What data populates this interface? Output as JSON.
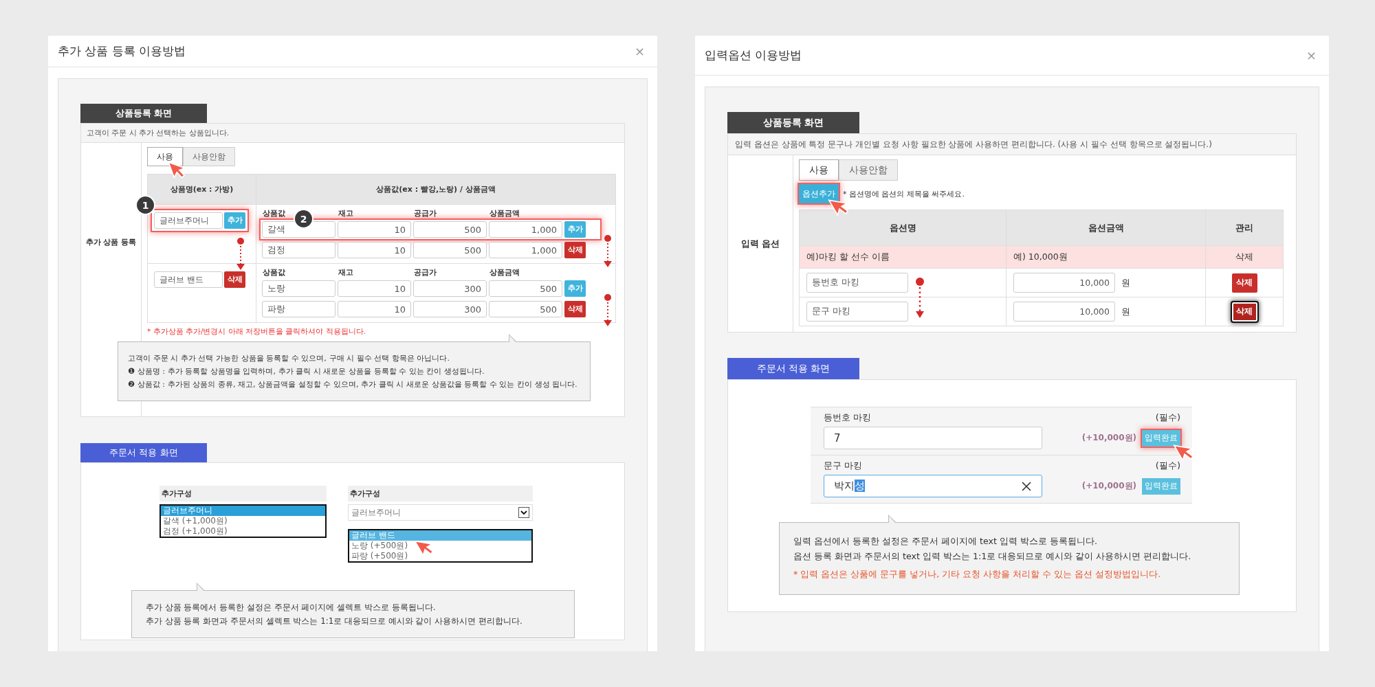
{
  "left_dialog": {
    "title": "추가 상품 등록 이용방법",
    "close": "×",
    "registration": {
      "heading": "상품등록 화면",
      "description": "고객이 주문 시 추가 선택하는 상품입니다.",
      "row_label": "추가 상품 등록",
      "tabs": [
        {
          "label": "사용",
          "selected": true
        },
        {
          "label": "사용안함",
          "selected": false
        }
      ],
      "columns": [
        "상품명(ex : 가방)",
        "상품값(ex : 빨강,노랑) / 상품금액"
      ],
      "groups": [
        {
          "marker": "1",
          "name": "글러브주머니",
          "button": {
            "label": "추가",
            "kind": "add"
          },
          "highlighted": true,
          "value_headers": [
            "상품값",
            "재고",
            "공급가",
            "상품금액"
          ],
          "values": [
            {
              "marker": "2",
              "highlighted": true,
              "cells": [
                "갈색",
                "10",
                "500",
                "1,000"
              ],
              "button": {
                "label": "추가",
                "kind": "add"
              }
            },
            {
              "highlighted": false,
              "cells": [
                "검정",
                "10",
                "500",
                "1,000"
              ],
              "button": {
                "label": "삭제",
                "kind": "delete"
              }
            }
          ]
        },
        {
          "name": "글러브 밴드",
          "button": {
            "label": "삭제",
            "kind": "delete"
          },
          "highlighted": false,
          "value_headers": [
            "상품값",
            "재고",
            "공급가",
            "상품금액"
          ],
          "values": [
            {
              "highlighted": false,
              "cells": [
                "노랑",
                "10",
                "300",
                "500"
              ],
              "button": {
                "label": "추가",
                "kind": "add"
              }
            },
            {
              "highlighted": false,
              "cells": [
                "파랑",
                "10",
                "300",
                "500"
              ],
              "button": {
                "label": "삭제",
                "kind": "delete"
              }
            }
          ]
        }
      ],
      "note": "* 추가상품 추가/변경시 아래 저장버튼을 클릭하셔야 적용됩니다.",
      "callout": [
        "고객이 주문 시 추가 선택 가능한 상품을 등록할 수 있으며, 구매 시 필수 선택 항목은 아닙니다.",
        "❶ 상품명 : 추가 등록할 상품명을 입력하며, 추가 클릭 시 새로운 상품을 등록할 수 있는 칸이 생성됩니다.",
        "❷ 상품값 : 추가된 상품의 종류, 재고, 상품금액을 설정할 수 있으며, 추가 클릭 시 새로운 상품값을 등록할 수 있는 칸이 생성 됩니다."
      ]
    },
    "order": {
      "heading": "주문서 적용 화면",
      "selects": [
        {
          "label": "추가구성",
          "kind": "listbox",
          "options": [
            {
              "text": "글러브주머니",
              "selected": true
            },
            {
              "text": "갈색 (+1,000원)",
              "selected": false
            },
            {
              "text": "검정 (+1,000원)",
              "selected": false
            }
          ]
        },
        {
          "label": "추가구성",
          "kind": "dropdown",
          "value": "글러브주머니",
          "options": [
            {
              "text": "글러브 밴드",
              "selected": true
            },
            {
              "text": "노랑 (+500원)",
              "selected": false
            },
            {
              "text": "파랑 (+500원)",
              "selected": false
            }
          ]
        }
      ],
      "callout": [
        "추가 상품 등록에서 등록한 설정은 주문서 페이지에 셀렉트 박스로 등록됩니다.",
        "추가 상품 등록 화면과 주문서의 셀렉트 박스는 1:1로 대응되므로 예시와 같이 사용하시면 편리합니다."
      ]
    }
  },
  "right_dialog": {
    "title": "입력옵션 이용방법",
    "close": "×",
    "registration": {
      "heading": "상품등록 화면",
      "description": "입력 옵션은 상품에 특정 문구나 개인별 요청 사항 필요한 상품에 사용하면 편리합니다. (사용 시 필수 선택 항목으로 설정됩니다.)",
      "row_label": "입력 옵션",
      "tabs": [
        {
          "label": "사용",
          "selected": true
        },
        {
          "label": "사용안함",
          "selected": false
        }
      ],
      "add_button": {
        "label": "옵션추가",
        "highlighted": true
      },
      "hint": "* 옵션명에 옵션의 제목을 써주세요.",
      "columns": [
        "옵션명",
        "옵션금액",
        "관리"
      ],
      "example_row": [
        "예)마킹 할 선수 이름",
        "예) 10,000원",
        "삭제"
      ],
      "rows": [
        {
          "name": "등번호 마킹",
          "amount": "10,000",
          "unit": "원",
          "button": "삭제",
          "pressed": false
        },
        {
          "name": "문구 마킹",
          "amount": "10,000",
          "unit": "원",
          "button": "삭제",
          "pressed": true
        }
      ]
    },
    "order": {
      "heading": "주문서 적용 화면",
      "fields": [
        {
          "label": "등번호 마킹",
          "required": "(필수)",
          "value": "7",
          "price": "(+10,000원)",
          "button": "입력완료",
          "highlighted": true,
          "focused": false
        },
        {
          "label": "문구 마킹",
          "required": "(필수)",
          "value": "박지",
          "composing": "성",
          "price": "(+10,000원)",
          "button": "입력완료",
          "highlighted": false,
          "focused": true
        }
      ],
      "callout": [
        {
          "text": "일력 옵션에서 등록한 설정은 주문서 페이지에 text 입력 박스로 등록됩니다.",
          "kind": "plain"
        },
        {
          "text": "옵션 등록 화면과 주문서의 text 입력 박스는 1:1로 대응되므로 예시와 같이 사용하시면 편리합니다.",
          "kind": "plain"
        },
        {
          "text": "* 입력 옵션은 상품에 문구를 넣거나, 기타 요청 사항을 처리할 수 있는 옵션 설정방법입니다.",
          "kind": "note"
        }
      ]
    }
  }
}
